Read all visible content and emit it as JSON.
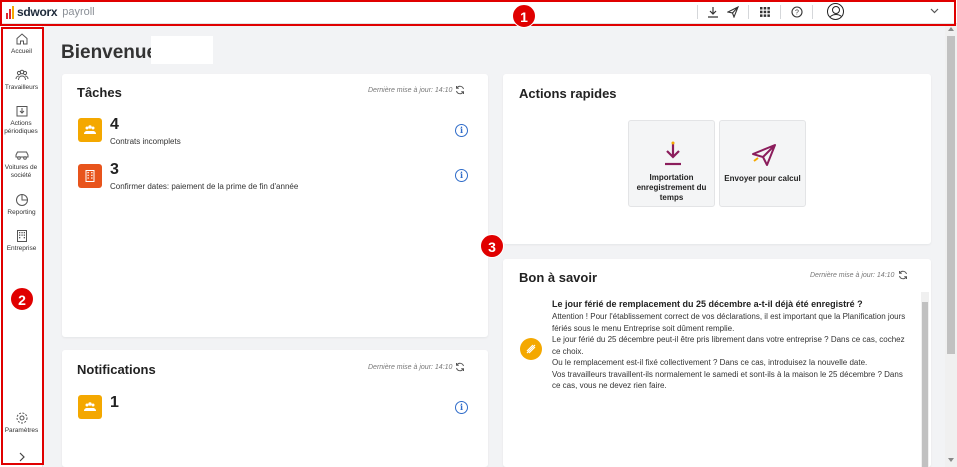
{
  "app": {
    "brand": "sdworx",
    "product": "payroll",
    "brand_color": "#e1262d"
  },
  "topbar": {
    "icons": [
      "download-icon",
      "send-icon",
      "apps-grid-icon",
      "help-icon",
      "user-avatar-icon",
      "chevron-down-icon"
    ]
  },
  "sidebar": {
    "items": [
      {
        "label": "Accueil",
        "icon": "home-icon"
      },
      {
        "label": "Travailleurs",
        "icon": "workers-icon"
      },
      {
        "label": "Actions périodiques",
        "icon": "periodic-actions-icon"
      },
      {
        "label": "Voitures de société",
        "icon": "car-icon"
      },
      {
        "label": "Reporting",
        "icon": "pie-chart-icon"
      },
      {
        "label": "Entreprise",
        "icon": "building-icon"
      }
    ],
    "settings_label": "Paramètres",
    "expand_icon": "chevron-right-icon"
  },
  "main": {
    "title": "Bienvenue"
  },
  "tasks": {
    "title": "Tâches",
    "updated": "Dernière mise à jour: 14:10",
    "items": [
      {
        "count": "4",
        "label": "Contrats incomplets",
        "color": "#f4a800"
      },
      {
        "count": "3",
        "label": "Confirmer dates: paiement de la prime de fin d'année",
        "color": "#e8541c"
      }
    ]
  },
  "notifications": {
    "title": "Notifications",
    "updated": "Dernière mise à jour: 14:10",
    "items": [
      {
        "count": "1",
        "color": "#f4a800"
      }
    ]
  },
  "quick_actions": {
    "title": "Actions rapides",
    "tiles": [
      {
        "label": "Importation enregistrement du temps",
        "icon": "download-icon"
      },
      {
        "label": "Envoyer pour calcul",
        "icon": "send-icon"
      }
    ]
  },
  "good_to_know": {
    "title": "Bon à savoir",
    "updated": "Dernière mise à jour: 14:10",
    "article_title": "Le jour férié de remplacement du 25 décembre a-t-il déjà été enregistré ?",
    "lines": [
      "Attention ! Pour l'établissement correct de vos déclarations, il est important que la Planification jours",
      "fériés sous le menu Entreprise soit dûment remplie.",
      "Le jour férié du 25 décembre peut-il être pris librement dans votre entreprise ? Dans ce cas, cochez",
      "ce choix.",
      "Ou le remplacement est-il fixé collectivement ? Dans ce cas, introduisez la nouvelle date.",
      "Vos travailleurs travaillent-ils normalement le samedi et sont-ils à la maison le 25 décembre ? Dans",
      "ce cas, vous ne devez rien faire."
    ]
  },
  "annotations": [
    "1",
    "2",
    "3"
  ],
  "colors": {
    "accent": "#2f6cc9",
    "annotation": "#e00000",
    "purple_icon": "#8b1d5c"
  }
}
